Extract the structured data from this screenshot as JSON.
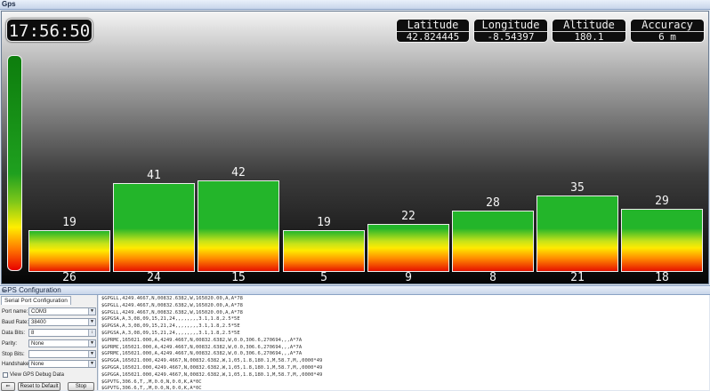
{
  "window": {
    "title": "Gps"
  },
  "clock": "17:56:50",
  "info": [
    {
      "label": "Latitude",
      "value": "42.824445"
    },
    {
      "label": "Longitude",
      "value": "-8.54397"
    },
    {
      "label": "Altitude",
      "value": "180.1"
    },
    {
      "label": "Accuracy",
      "value": "6 m"
    }
  ],
  "satellites": [
    {
      "snr": 19,
      "prn": "26"
    },
    {
      "snr": 41,
      "prn": "24"
    },
    {
      "snr": 42,
      "prn": "15"
    },
    {
      "snr": 19,
      "prn": "5"
    },
    {
      "snr": 22,
      "prn": "9"
    },
    {
      "snr": 28,
      "prn": "8"
    },
    {
      "snr": 35,
      "prn": "21"
    },
    {
      "snr": 29,
      "prn": "18"
    }
  ],
  "config": {
    "title": "GPS Configuration",
    "collapse_icon": "chevron-double-down-icon",
    "tab": "Serial Port Configuration",
    "fields": [
      {
        "label": "Port name:",
        "value": "COM3"
      },
      {
        "label": "Baud Rate:",
        "value": "38400"
      },
      {
        "label": "Data Bits:",
        "value": "8"
      },
      {
        "label": "Parity:",
        "value": "None"
      },
      {
        "label": "Stop Bits:",
        "value": ""
      },
      {
        "label": "Handshake:",
        "value": "None"
      }
    ],
    "debug_label": "View GPS Debug Data",
    "reset_label": "Reset to Default",
    "stop_label": "Stop"
  },
  "nmea": [
    "$GPGLL,4249.4667,N,00832.6382,W,165020.00,A,A*78",
    "$GPGLL,4249.4667,N,00832.6382,W,165020.00,A,A*78",
    "$GPGLL,4249.4667,N,00832.6382,W,165020.00,A,A*78",
    "$GPGSA,A,3,08,09,15,21,24,,,,,,,,3.1,1.8,2.5*5E",
    "$GPGSA,A,3,08,09,15,21,24,,,,,,,,3.1,1.8,2.5*5E",
    "$GPGSA,A,3,08,09,15,21,24,,,,,,,,3.1,1.8,2.5*5E",
    "$GPRMC,165021.000,A,4249.4667,N,00832.6382,W,0.0,306.6,270694,,,A*7A",
    "$GPRMC,165021.000,A,4249.4667,N,00832.6382,W,0.0,306.6,270694,,,A*7A",
    "$GPRMC,165021.000,A,4249.4667,N,00832.6382,W,0.0,306.6,270694,,,A*7A",
    "$GPGGA,165021.000,4249.4667,N,00832.6382,W,1,05,1.8,180.1,M,58.7,M,,0000*49",
    "$GPGGA,165021.000,4249.4667,N,00832.6382,W,1,05,1.8,180.1,M,58.7,M,,0000*49",
    "$GPGGA,165021.000,4249.4667,N,00832.6382,W,1,05,1.8,180.1,M,58.7,M,,0000*49",
    "$GPVTG,306.6,T,,M,0.0,N,0.0,K,A*0C",
    "$GPVTG,306.6,T,,M,0.0,N,0.0,K,A*0C",
    "$GPVTG,306.6,T,,M,0.0,N,0.0,K,A*0C"
  ]
}
